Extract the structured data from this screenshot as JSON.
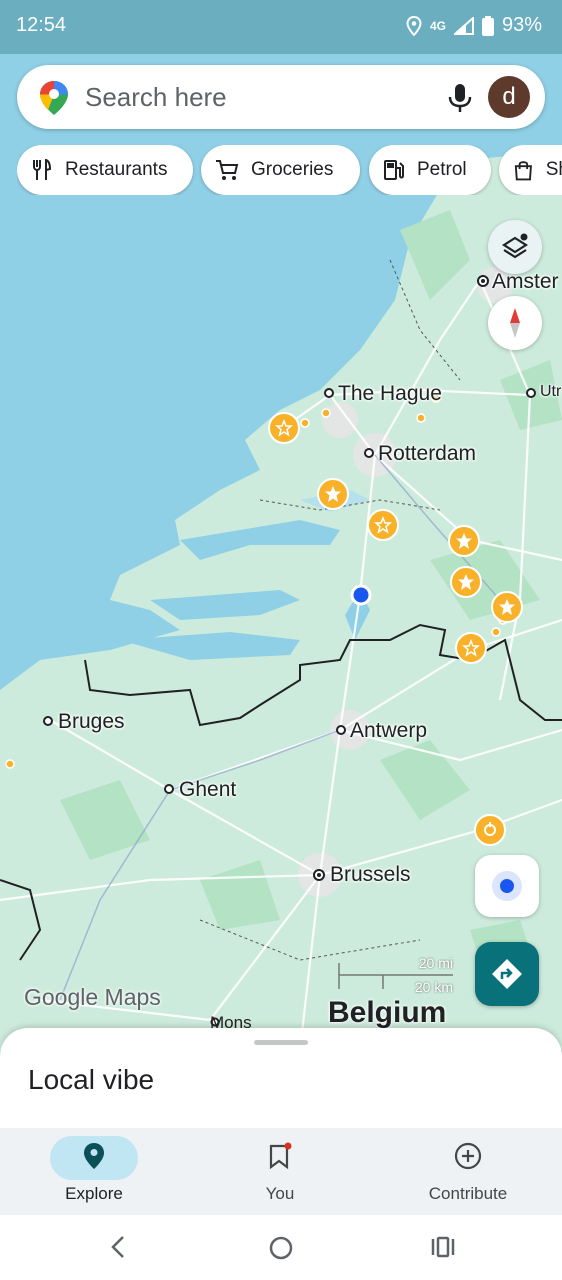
{
  "status_bar": {
    "time": "12:54",
    "network": "4G",
    "battery": "93%"
  },
  "search": {
    "placeholder": "Search here",
    "avatar_letter": "d"
  },
  "chips": [
    {
      "label": "Restaurants",
      "icon": "fork-knife-icon"
    },
    {
      "label": "Groceries",
      "icon": "cart-icon"
    },
    {
      "label": "Petrol",
      "icon": "fuel-icon"
    },
    {
      "label": "Sh",
      "icon": "shopping-bag-icon"
    }
  ],
  "map_labels": {
    "amsterdam": "Amster",
    "utrecht": "Utr",
    "the_hague": "The Hague",
    "rotterdam": "Rotterdam",
    "bruges": "Bruges",
    "antwerp": "Antwerp",
    "ghent": "Ghent",
    "brussels": "Brussels",
    "mons": "Mons",
    "belgium": "Belgium",
    "partial_n": "n"
  },
  "scale": {
    "mi": "20 mi",
    "km": "20 km"
  },
  "google_maps_logo": "Google Maps",
  "sheet": {
    "title": "Local vibe"
  },
  "bottom_nav": [
    {
      "label": "Explore",
      "icon": "pin-icon",
      "active": true
    },
    {
      "label": "You",
      "icon": "bookmark-icon",
      "active": false
    },
    {
      "label": "Contribute",
      "icon": "add-circle-icon",
      "active": false
    }
  ],
  "colors": {
    "water": "#8fd0e6",
    "land": "#cdebdc",
    "accent": "#08717a",
    "marker": "#f9b12a"
  }
}
